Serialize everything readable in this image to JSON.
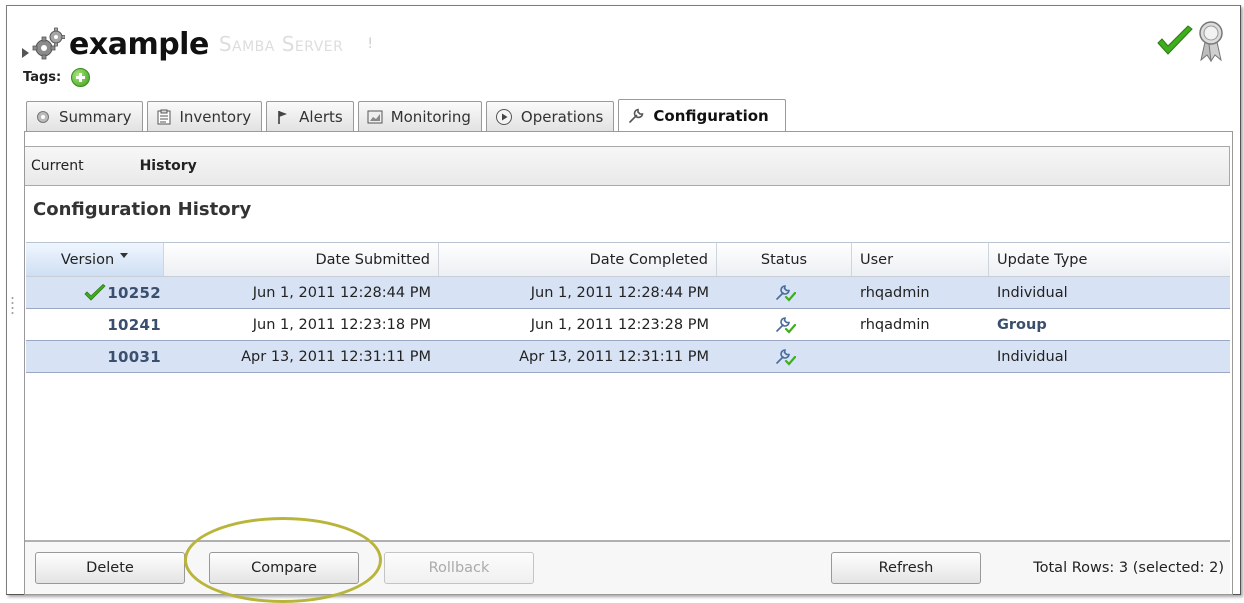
{
  "resource": {
    "name": "example",
    "type": "Samba Server",
    "type_suffix": "!"
  },
  "tags_label": "Tags:",
  "tabs": [
    {
      "label": "Summary",
      "icon": "gear-icon"
    },
    {
      "label": "Inventory",
      "icon": "clipboard-icon"
    },
    {
      "label": "Alerts",
      "icon": "flag-icon"
    },
    {
      "label": "Monitoring",
      "icon": "monitor-icon"
    },
    {
      "label": "Operations",
      "icon": "play-icon"
    },
    {
      "label": "Configuration",
      "icon": "wrench-icon",
      "active": true
    }
  ],
  "subtabs": {
    "current": "Current",
    "history": "History"
  },
  "section_title": "Configuration History",
  "table": {
    "columns": [
      "Version",
      "Date Submitted",
      "Date Completed",
      "Status",
      "User",
      "Update Type"
    ],
    "rows": [
      {
        "version": "10252",
        "submitted": "Jun 1, 2011 12:28:44 PM",
        "completed": "Jun 1, 2011 12:28:44 PM",
        "user": "rhqadmin",
        "update_type": "Individual",
        "current": true,
        "selected": true
      },
      {
        "version": "10241",
        "submitted": "Jun 1, 2011 12:23:18 PM",
        "completed": "Jun 1, 2011 12:23:28 PM",
        "user": "rhqadmin",
        "update_type": "Group",
        "current": false,
        "selected": false
      },
      {
        "version": "10031",
        "submitted": "Apr 13, 2011 12:31:11 PM",
        "completed": "Apr 13, 2011 12:31:11 PM",
        "user": "",
        "update_type": "Individual",
        "current": false,
        "selected": true
      }
    ]
  },
  "toolbar": {
    "delete": "Delete",
    "compare": "Compare",
    "rollback": "Rollback",
    "refresh": "Refresh",
    "total": "Total Rows: 3 (selected: 2)"
  },
  "colors": {
    "selected_row": "#d7e3f5",
    "version_text": "#3a4e6e",
    "success_green": "#3f9d1e",
    "highlight_ring": "#b9b53a"
  }
}
